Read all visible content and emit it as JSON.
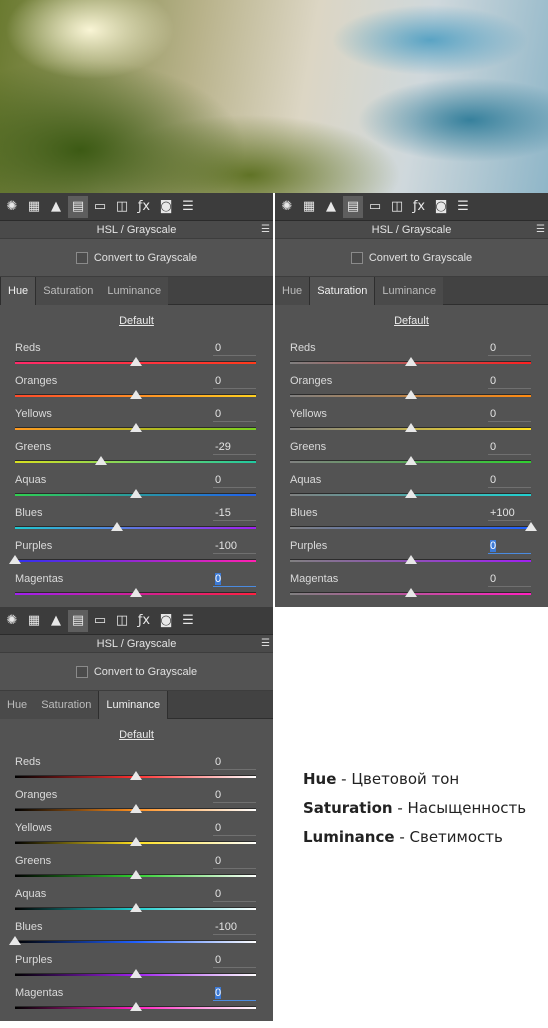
{
  "tab_labels": [
    "Hue",
    "Saturation",
    "Luminance"
  ],
  "panels": [
    {
      "title": "HSL / Grayscale",
      "convert_label": "Convert to Grayscale",
      "active_tab": 0,
      "default_label": "Default",
      "sliders": [
        {
          "label": "Reds",
          "value": "0",
          "num": 0
        },
        {
          "label": "Oranges",
          "value": "0",
          "num": 0
        },
        {
          "label": "Yellows",
          "value": "0",
          "num": 0
        },
        {
          "label": "Greens",
          "value": "-29",
          "num": -29
        },
        {
          "label": "Aquas",
          "value": "0",
          "num": 0
        },
        {
          "label": "Blues",
          "value": "-15",
          "num": -15
        },
        {
          "label": "Purples",
          "value": "-100",
          "num": -100
        },
        {
          "label": "Magentas",
          "value": "0",
          "num": 0,
          "selected": true
        }
      ]
    },
    {
      "title": "HSL / Grayscale",
      "convert_label": "Convert to Grayscale",
      "active_tab": 1,
      "default_label": "Default",
      "sliders": [
        {
          "label": "Reds",
          "value": "0",
          "num": 0
        },
        {
          "label": "Oranges",
          "value": "0",
          "num": 0
        },
        {
          "label": "Yellows",
          "value": "0",
          "num": 0
        },
        {
          "label": "Greens",
          "value": "0",
          "num": 0
        },
        {
          "label": "Aquas",
          "value": "0",
          "num": 0
        },
        {
          "label": "Blues",
          "value": "+100",
          "num": 100
        },
        {
          "label": "Purples",
          "value": "0",
          "num": 0,
          "selected": true
        },
        {
          "label": "Magentas",
          "value": "0",
          "num": 0
        }
      ]
    },
    {
      "title": "HSL / Grayscale",
      "convert_label": "Convert to Grayscale",
      "active_tab": 2,
      "default_label": "Default",
      "sliders": [
        {
          "label": "Reds",
          "value": "0",
          "num": 0
        },
        {
          "label": "Oranges",
          "value": "0",
          "num": 0
        },
        {
          "label": "Yellows",
          "value": "0",
          "num": 0
        },
        {
          "label": "Greens",
          "value": "0",
          "num": 0
        },
        {
          "label": "Aquas",
          "value": "0",
          "num": 0
        },
        {
          "label": "Blues",
          "value": "-100",
          "num": -100
        },
        {
          "label": "Purples",
          "value": "0",
          "num": 0
        },
        {
          "label": "Magentas",
          "value": "0",
          "num": 0,
          "selected": true
        }
      ]
    }
  ],
  "toolbar_icons": [
    {
      "name": "aperture-icon",
      "glyph": "✺"
    },
    {
      "name": "grid-icon",
      "glyph": "▦"
    },
    {
      "name": "mountains-icon",
      "glyph": "▲"
    },
    {
      "name": "hsl-icon",
      "glyph": "▤"
    },
    {
      "name": "split-toning-icon",
      "glyph": "▭"
    },
    {
      "name": "lens-icon",
      "glyph": "◫"
    },
    {
      "name": "fx-icon",
      "glyph": "ƒx"
    },
    {
      "name": "camera-icon",
      "glyph": "◙"
    },
    {
      "name": "presets-icon",
      "glyph": "☰"
    }
  ],
  "track_colors": {
    "hue": [
      "#ff2a6a|#ff3a1a",
      "#ff4a2a|#ffd020",
      "#ff9a20|#7ad020",
      "#d8e020|#20c8a0",
      "#30d050|#2060f0",
      "#20c8d0|#a020f0",
      "#3030f0|#ff20b0",
      "#a020f0|#ff2040"
    ],
    "saturation": [
      "#808080|#ff2020",
      "#808080|#ff8a10",
      "#808080|#ffe020",
      "#808080|#30d030",
      "#808080|#20d0d0",
      "#808080|#2060ff",
      "#808080|#a020f0",
      "#808080|#ff20c0"
    ],
    "luminance": [
      "#000000|#ff3030|#ffffff",
      "#000000|#ff9020|#ffffff",
      "#000000|#ffe020|#ffffff",
      "#000000|#30d030|#ffffff",
      "#000000|#20d0d0|#ffffff",
      "#000000|#2060ff|#ffffff",
      "#000000|#a020f0|#ffffff",
      "#000000|#ff20c0|#ffffff"
    ]
  },
  "legend": [
    {
      "term": "Hue",
      "desc": " - Цветовой тон"
    },
    {
      "term": "Saturation",
      "desc": " - Насыщенность"
    },
    {
      "term": "Luminance",
      "desc": " - Светимость"
    }
  ]
}
